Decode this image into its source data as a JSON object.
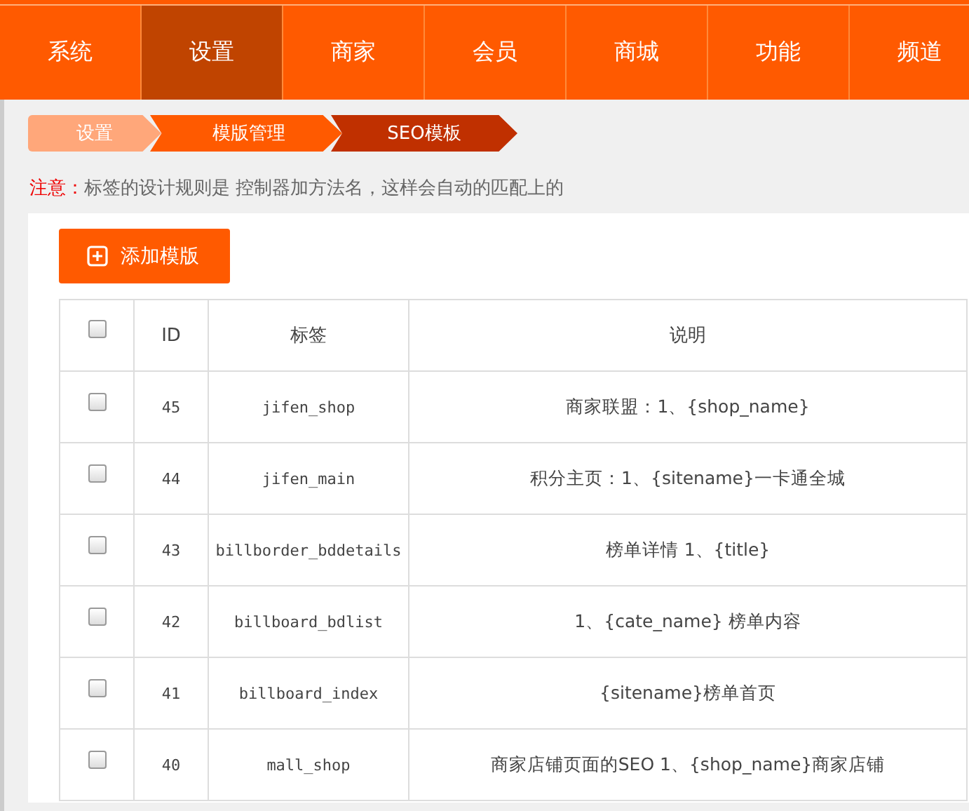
{
  "nav": [
    {
      "label": "系统",
      "selected": false
    },
    {
      "label": "设置",
      "selected": true
    },
    {
      "label": "商家",
      "selected": false
    },
    {
      "label": "会员",
      "selected": false
    },
    {
      "label": "商城",
      "selected": false
    },
    {
      "label": "功能",
      "selected": false
    },
    {
      "label": "频道",
      "selected": false
    }
  ],
  "breadcrumb": [
    "设置",
    "模版管理",
    "SEO模板"
  ],
  "notice": {
    "label": "注意：",
    "text": "标签的设计规则是 控制器加方法名，这样会自动的匹配上的"
  },
  "add_button": "添加模版",
  "table": {
    "columns": [
      "ID",
      "标签",
      "说明"
    ],
    "header_checked": false,
    "rows": [
      {
        "checked": false,
        "id": "45",
        "tag": "jifen_shop",
        "description": "商家联盟：1、{shop_name}"
      },
      {
        "checked": false,
        "id": "44",
        "tag": "jifen_main",
        "description": "积分主页：1、{sitename}一卡通全城"
      },
      {
        "checked": false,
        "id": "43",
        "tag": "billborder_bddetails",
        "description": "榜单详情 1、{title}"
      },
      {
        "checked": false,
        "id": "42",
        "tag": "billboard_bdlist",
        "description": "1、{cate_name} 榜单内容"
      },
      {
        "checked": false,
        "id": "41",
        "tag": "billboard_index",
        "description": "{sitename}榜单首页"
      },
      {
        "checked": false,
        "id": "40",
        "tag": "mall_shop",
        "description": "商家店铺页面的SEO 1、{shop_name}商家店铺"
      }
    ]
  }
}
